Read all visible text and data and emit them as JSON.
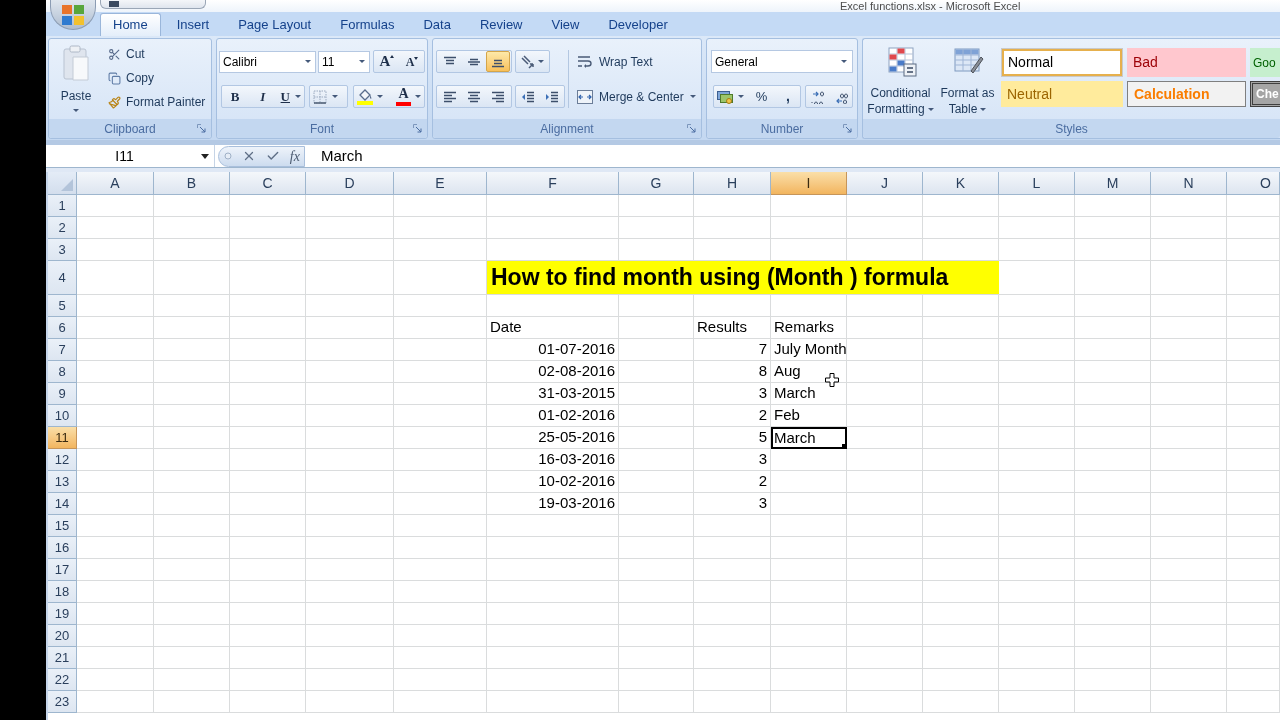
{
  "window": {
    "title": "Excel functions.xlsx - Microsoft Excel"
  },
  "ribbon_tabs": [
    {
      "label": "Home",
      "selected": true
    },
    {
      "label": "Insert",
      "selected": false
    },
    {
      "label": "Page Layout",
      "selected": false
    },
    {
      "label": "Formulas",
      "selected": false
    },
    {
      "label": "Data",
      "selected": false
    },
    {
      "label": "Review",
      "selected": false
    },
    {
      "label": "View",
      "selected": false
    },
    {
      "label": "Developer",
      "selected": false
    }
  ],
  "ribbon": {
    "clipboard": {
      "label": "Clipboard",
      "paste": "Paste",
      "actions": [
        {
          "kind": "cut",
          "label": "Cut"
        },
        {
          "kind": "copy",
          "label": "Copy"
        },
        {
          "kind": "format_painter",
          "label": "Format Painter"
        }
      ]
    },
    "font": {
      "label": "Font",
      "font_name": "Calibri",
      "font_size": "11",
      "grow_font": "A",
      "shrink_font": "A",
      "bold": "B",
      "italic": "I",
      "underline": "U",
      "font_color_label": "A"
    },
    "alignment": {
      "label": "Alignment",
      "vertical": [
        {
          "kind": "top",
          "selected": false
        },
        {
          "kind": "middle",
          "selected": false
        },
        {
          "kind": "bottom",
          "selected": true
        }
      ],
      "horizontal": [
        {
          "kind": "left",
          "selected": false
        },
        {
          "kind": "center",
          "selected": false
        },
        {
          "kind": "right",
          "selected": false
        }
      ],
      "wrap_text": "Wrap Text",
      "merge_center": "Merge & Center"
    },
    "number": {
      "label": "Number",
      "format": "General",
      "percent": "%",
      "comma": ","
    },
    "styles": {
      "label": "Styles",
      "conditional_formatting": "Conditional Formatting",
      "format_as_table": "Format as Table",
      "gallery": [
        {
          "kind": "normal",
          "label": "Normal",
          "selected": true
        },
        {
          "kind": "bad",
          "label": "Bad",
          "selected": false
        },
        {
          "kind": "good",
          "label": "Goo",
          "selected": false
        },
        {
          "kind": "neutral",
          "label": "Neutral",
          "selected": false
        },
        {
          "kind": "calculation",
          "label": "Calculation",
          "selected": false
        },
        {
          "kind": "check",
          "label": "Che",
          "selected": false
        }
      ]
    }
  },
  "formula_bar": {
    "name_box": "I11",
    "function_button": "fx",
    "formula": "March"
  },
  "sheet": {
    "columns": [
      {
        "label": "A",
        "selected": false
      },
      {
        "label": "B",
        "selected": false
      },
      {
        "label": "C",
        "selected": false
      },
      {
        "label": "D",
        "selected": false
      },
      {
        "label": "E",
        "selected": false
      },
      {
        "label": "F",
        "selected": false
      },
      {
        "label": "G",
        "selected": false
      },
      {
        "label": "H",
        "selected": false
      },
      {
        "label": "I",
        "selected": true
      },
      {
        "label": "J",
        "selected": false
      },
      {
        "label": "K",
        "selected": false
      },
      {
        "label": "L",
        "selected": false
      },
      {
        "label": "M",
        "selected": false
      },
      {
        "label": "N",
        "selected": false
      },
      {
        "label": "O",
        "selected": false
      }
    ],
    "rows": [
      {
        "label": "1",
        "selected": false
      },
      {
        "label": "2",
        "selected": false
      },
      {
        "label": "3",
        "selected": false
      },
      {
        "label": "4",
        "selected": false
      },
      {
        "label": "5",
        "selected": false
      },
      {
        "label": "6",
        "selected": false
      },
      {
        "label": "7",
        "selected": false
      },
      {
        "label": "8",
        "selected": false
      },
      {
        "label": "9",
        "selected": false
      },
      {
        "label": "10",
        "selected": false
      },
      {
        "label": "11",
        "selected": true
      },
      {
        "label": "12",
        "selected": false
      },
      {
        "label": "13",
        "selected": false
      },
      {
        "label": "14",
        "selected": false
      },
      {
        "label": "15",
        "selected": false
      },
      {
        "label": "16",
        "selected": false
      },
      {
        "label": "17",
        "selected": false
      },
      {
        "label": "18",
        "selected": false
      },
      {
        "label": "19",
        "selected": false
      },
      {
        "label": "20",
        "selected": false
      },
      {
        "label": "21",
        "selected": false
      },
      {
        "label": "22",
        "selected": false
      },
      {
        "label": "23",
        "selected": false
      }
    ],
    "title": "How to find month using (Month ) formula",
    "headers": {
      "date": "Date",
      "results": "Results",
      "remarks": "Remarks"
    },
    "records": [
      {
        "date": "01-07-2016",
        "result": "7",
        "remark": "July Month",
        "selected": false
      },
      {
        "date": "02-08-2016",
        "result": "8",
        "remark": "Aug",
        "selected": false
      },
      {
        "date": "31-03-2015",
        "result": "3",
        "remark": "March",
        "selected": false
      },
      {
        "date": "01-02-2016",
        "result": "2",
        "remark": "Feb",
        "selected": false
      },
      {
        "date": "25-05-2016",
        "result": "5",
        "remark": "March",
        "selected": true
      },
      {
        "date": "16-03-2016",
        "result": "3",
        "selected": false
      },
      {
        "date": "10-02-2016",
        "result": "2",
        "selected": false
      },
      {
        "date": "19-03-2016",
        "result": "3",
        "selected": false
      }
    ]
  }
}
